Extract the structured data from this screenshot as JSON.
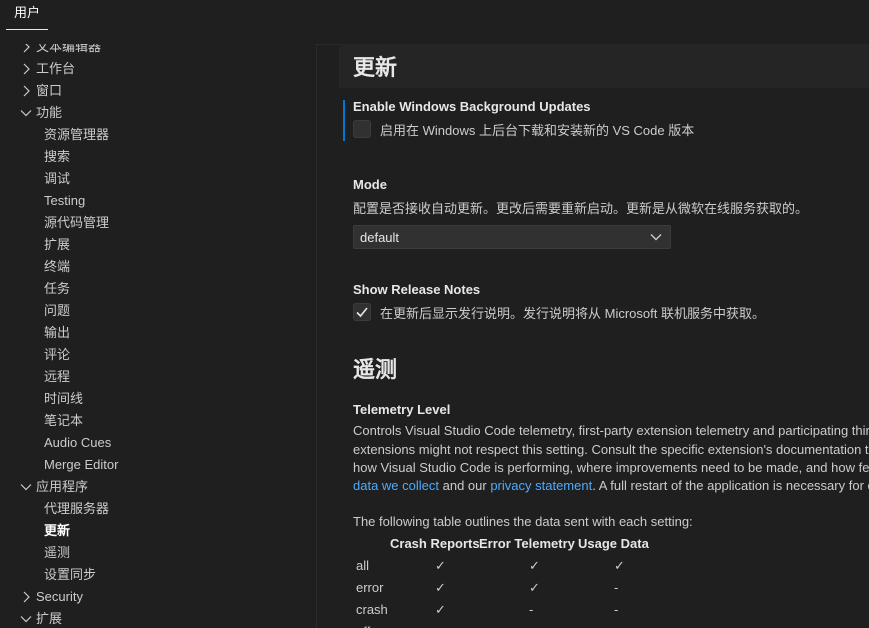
{
  "tabs": [
    {
      "label": "用户"
    }
  ],
  "tree": [
    {
      "label": "文本编辑器",
      "level": 0,
      "expanded": false
    },
    {
      "label": "工作台",
      "level": 0,
      "expanded": false
    },
    {
      "label": "窗口",
      "level": 0,
      "expanded": false
    },
    {
      "label": "功能",
      "level": 0,
      "expanded": true
    },
    {
      "label": "资源管理器",
      "level": 1
    },
    {
      "label": "搜索",
      "level": 1
    },
    {
      "label": "调试",
      "level": 1
    },
    {
      "label": "Testing",
      "level": 1
    },
    {
      "label": "源代码管理",
      "level": 1
    },
    {
      "label": "扩展",
      "level": 1
    },
    {
      "label": "终端",
      "level": 1
    },
    {
      "label": "任务",
      "level": 1
    },
    {
      "label": "问题",
      "level": 1
    },
    {
      "label": "输出",
      "level": 1
    },
    {
      "label": "评论",
      "level": 1
    },
    {
      "label": "远程",
      "level": 1
    },
    {
      "label": "时间线",
      "level": 1
    },
    {
      "label": "笔记本",
      "level": 1
    },
    {
      "label": "Audio Cues",
      "level": 1
    },
    {
      "label": "Merge Editor",
      "level": 1
    },
    {
      "label": "应用程序",
      "level": 0,
      "expanded": true
    },
    {
      "label": "代理服务器",
      "level": 1
    },
    {
      "label": "更新",
      "level": 1,
      "active": true
    },
    {
      "label": "遥测",
      "level": 1
    },
    {
      "label": "设置同步",
      "level": 1
    },
    {
      "label": "Security",
      "level": 0,
      "expanded": false
    },
    {
      "label": "扩展",
      "level": 0,
      "expanded": true
    }
  ],
  "update": {
    "heading": "更新",
    "bg_title": "Enable Windows Background Updates",
    "bg_label": "启用在 Windows 上后台下载和安装新的 VS Code 版本",
    "bg_checked": false,
    "mode_title": "Mode",
    "mode_desc": "配置是否接收自动更新。更改后需要重新启动。更新是从微软在线服务获取的。",
    "mode_value": "default",
    "notes_title": "Show Release Notes",
    "notes_label": "在更新后显示发行说明。发行说明将从 Microsoft 联机服务中获取。",
    "notes_checked": true
  },
  "telemetry": {
    "heading": "遥测",
    "title": "Telemetry Level",
    "line1": "Controls Visual Studio Code telemetry, first-party extension telemetry and participating third-party extension telemetry. Some third party",
    "line2": "extensions might not respect this setting. Consult the specific extension's documentation to be sure.",
    "line3": "how Visual Studio Code is performing, where improvements need to be made, and how features are being used. Read more about the",
    "link1": "data we collect",
    "mid": " and our ",
    "link2": "privacy statement",
    "line4_end": ". A full restart of the application is necessary for changes to take effect.",
    "table_intro": "The following table outlines the data sent with each setting:",
    "headers": [
      "Crash Reports",
      "Error Telemetry",
      "Usage Data"
    ],
    "rows": [
      {
        "name": "all",
        "cells": [
          "✓",
          "✓",
          "✓"
        ]
      },
      {
        "name": "error",
        "cells": [
          "✓",
          "✓",
          "-"
        ]
      },
      {
        "name": "crash",
        "cells": [
          "✓",
          "-",
          "-"
        ]
      },
      {
        "name": "off",
        "cells": [
          "-",
          "-",
          "-"
        ]
      }
    ]
  }
}
